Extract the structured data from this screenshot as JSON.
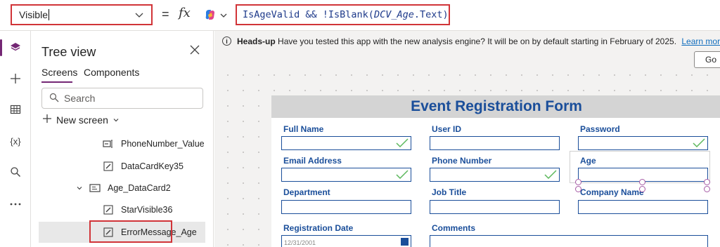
{
  "formula": {
    "property": "Visible",
    "eq": "=",
    "fx": "fx",
    "expr_func": "IsAgeValid && !IsBlank(",
    "expr_ctrl": "DCV_Age",
    "expr_tail": ".Text)"
  },
  "rail": [
    {
      "icon": "layers-icon",
      "active": true
    },
    {
      "icon": "plus-icon"
    },
    {
      "icon": "table-icon"
    },
    {
      "icon": "variables-icon",
      "text": "{x}"
    },
    {
      "icon": "search-icon"
    },
    {
      "icon": "more-icon"
    }
  ],
  "tree": {
    "title": "Tree view",
    "tabs": [
      "Screens",
      "Components"
    ],
    "search_placeholder": "Search",
    "new_screen": "New screen",
    "items": [
      {
        "label": "PhoneNumber_Value",
        "icon": "label-icon"
      },
      {
        "label": "DataCardKey35",
        "icon": "edit-icon"
      },
      {
        "label": "Age_DataCard2",
        "icon": "card-icon"
      },
      {
        "label": "StarVisible36",
        "icon": "edit-icon"
      },
      {
        "label": "ErrorMessage_Age",
        "icon": "edit-icon",
        "selected": true
      }
    ]
  },
  "banner": {
    "heading": "Heads-up",
    "message": "Have you tested this app with the new analysis engine? It will be on by default starting in February of 2025.",
    "link": "Learn more",
    "go": "Go"
  },
  "form": {
    "title": "Event Registration Form",
    "fields": {
      "full_name": "Full Name",
      "user_id": "User ID",
      "password": "Password",
      "email": "Email Address",
      "phone": "Phone Number",
      "age": "Age",
      "department": "Department",
      "job_title": "Job Title",
      "company": "Company Name",
      "reg_date": "Registration Date",
      "comments": "Comments"
    },
    "reg_date_value": "12/31/2001"
  },
  "colors": {
    "accent": "#742774",
    "highlight": "#d13438",
    "form_blue": "#1a4e9a",
    "check_green": "#5cb85c"
  }
}
